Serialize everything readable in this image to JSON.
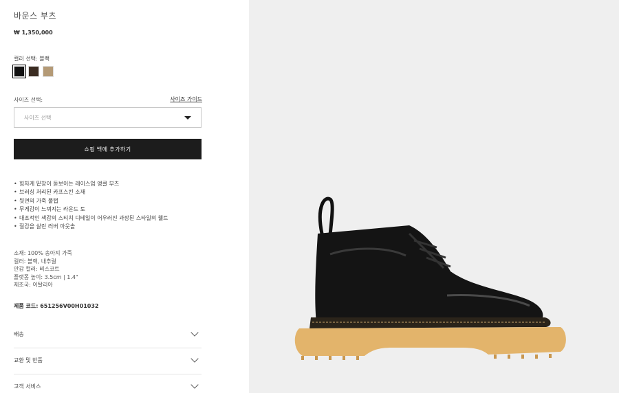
{
  "product": {
    "title": "바운스 부츠",
    "price": "₩ 1,350,000",
    "color_label": "컬러 선택: 블랙",
    "swatch_colors": [
      "#111111",
      "#3b2c22",
      "#b49a76"
    ],
    "size_label": "사이즈 선택:",
    "size_guide": "사이즈 가이드",
    "size_placeholder": "사이즈 선택",
    "add_to_bag": "쇼핑 백에 추가하기"
  },
  "features": [
    "힘차게 밑창이 돋보이는 레이스업 앵클 부츠",
    "브러싱 처리된 카프스킨 소재",
    "뒷면의 가죽 풀탭",
    "무게감이 느껴지는 라운드 토",
    "대조적인 색감의 스티치 디테일이 어우러진 과장된 스타일의 웰트",
    "질감을 살린 러버 아웃솔"
  ],
  "specs": [
    "소재: 100% 송아지 가죽",
    "컬러: 블랙, 내추럴",
    "안감 컬러: 비스코트",
    "플랫폼 높이: 3.5cm | 1.4\"",
    "제조국: 이탈리아"
  ],
  "product_code": "제품 코드: 651256V00H01032",
  "accordions": [
    "배송",
    "교환 및 반품",
    "고객 서비스"
  ]
}
